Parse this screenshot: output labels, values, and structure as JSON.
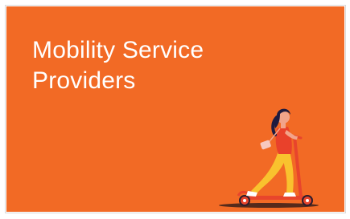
{
  "card": {
    "title_line_1": "Mobility Service",
    "title_line_2": "Providers"
  },
  "illustration": {
    "icon": "woman-riding-scooter-illustration"
  },
  "colors": {
    "banner": "#f26a25",
    "title_text": "#ffffff",
    "scooter": "#e8452c",
    "pants": "#f9c22e",
    "shirt": "#e9412b",
    "skin": "#f2a48a",
    "hair": "#1f1b3f"
  }
}
